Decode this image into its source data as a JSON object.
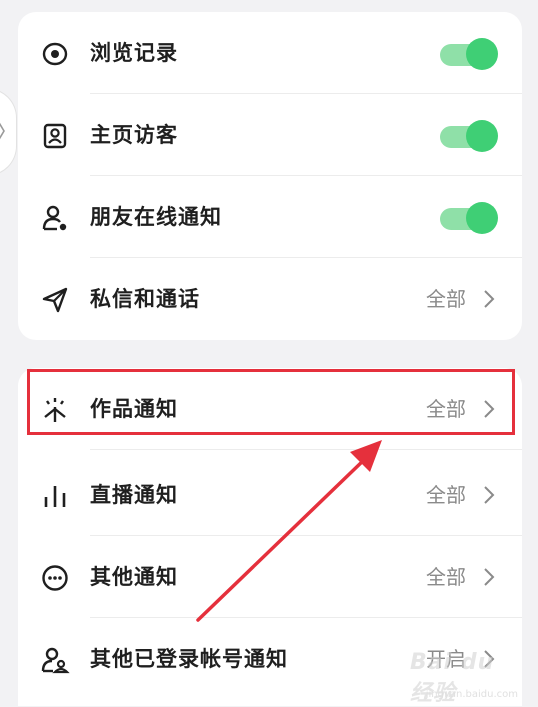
{
  "settings": {
    "group1": [
      {
        "label": "浏览记录",
        "icon": "eye-icon",
        "toggle": true
      },
      {
        "label": "主页访客",
        "icon": "profile-card-icon",
        "toggle": true
      },
      {
        "label": "朋友在线通知",
        "icon": "person-online-icon",
        "toggle": true
      },
      {
        "label": "私信和通话",
        "icon": "send-icon",
        "value": "全部"
      }
    ],
    "group2": [
      {
        "label": "作品通知",
        "icon": "sparkle-icon",
        "value": "全部"
      },
      {
        "label": "直播通知",
        "icon": "bars-icon",
        "value": "全部"
      },
      {
        "label": "其他通知",
        "icon": "more-circle-icon",
        "value": "全部"
      },
      {
        "label": "其他已登录帐号通知",
        "icon": "accounts-icon",
        "value": "开启"
      }
    ]
  },
  "colors": {
    "toggle_on": "#3fcf75",
    "toggle_track": "#8fe0a8",
    "highlight": "#e5303c",
    "background": "#f2f2f4"
  },
  "watermark": {
    "main": "Bai du 经验",
    "sub": "jingyan.baidu.com"
  }
}
